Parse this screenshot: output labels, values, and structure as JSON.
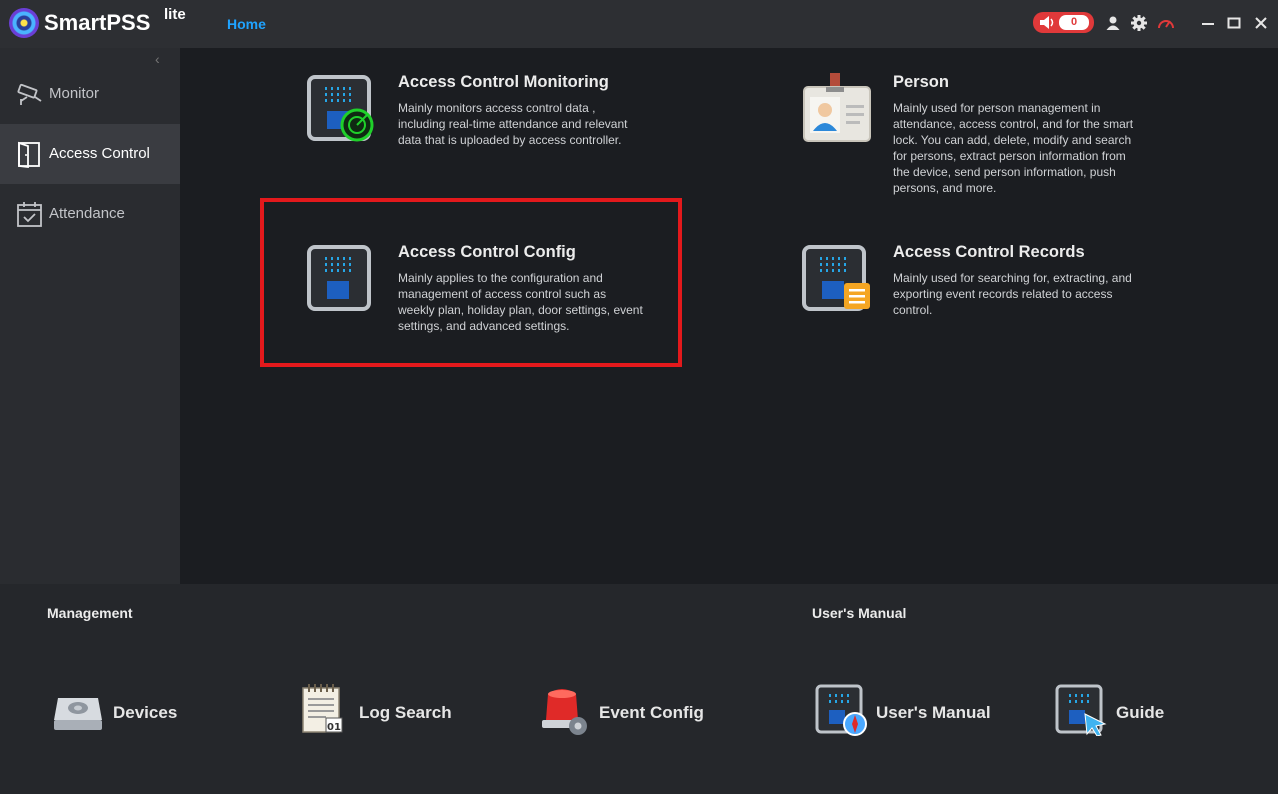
{
  "app": {
    "name": "SmartPSS",
    "edition": "lite"
  },
  "titlebar": {
    "home_tab": "Home",
    "alarm_count": "0"
  },
  "sidebar": {
    "items": [
      {
        "label": "Monitor",
        "icon": "cctv-camera-icon",
        "active": false
      },
      {
        "label": "Access Control",
        "icon": "door-icon",
        "active": true
      },
      {
        "label": "Attendance",
        "icon": "calendar-check-icon",
        "active": false
      }
    ]
  },
  "main": {
    "cards": [
      {
        "title": "Access Control Monitoring",
        "description": "Mainly monitors access control data , including real-time attendance and relevant data that is uploaded by access controller."
      },
      {
        "title": "Person",
        "description": "Mainly used for person management in attendance, access control, and for the smart lock. You can add, delete, modify and search for persons, extract person information from the device, send person information, push persons, and more."
      },
      {
        "title": "Access Control Config",
        "description": "Mainly applies to the configuration and management of access control such as weekly plan, holiday plan, door settings, event settings, and advanced settings."
      },
      {
        "title": "Access Control Records",
        "description": "Mainly used for searching for, extracting, and exporting event records related to access control."
      }
    ],
    "highlight_color": "#e3191c"
  },
  "bottom": {
    "management_title": "Management",
    "manual_title": "User's Manual",
    "tools": [
      {
        "label": "Devices",
        "icon": "device-drive-icon"
      },
      {
        "label": "Log Search",
        "icon": "log-notepad-icon"
      },
      {
        "label": "Event Config",
        "icon": "alarm-siren-gear-icon"
      },
      {
        "label": "User's Manual",
        "icon": "manual-compass-icon"
      },
      {
        "label": "Guide",
        "icon": "guide-cursor-icon"
      }
    ]
  },
  "colors": {
    "accent": "#1fa3ff",
    "alarm": "#e0393a",
    "titlebar": "#2d2f33",
    "sidebar": "#2a2c30",
    "main": "#1b1d21"
  }
}
